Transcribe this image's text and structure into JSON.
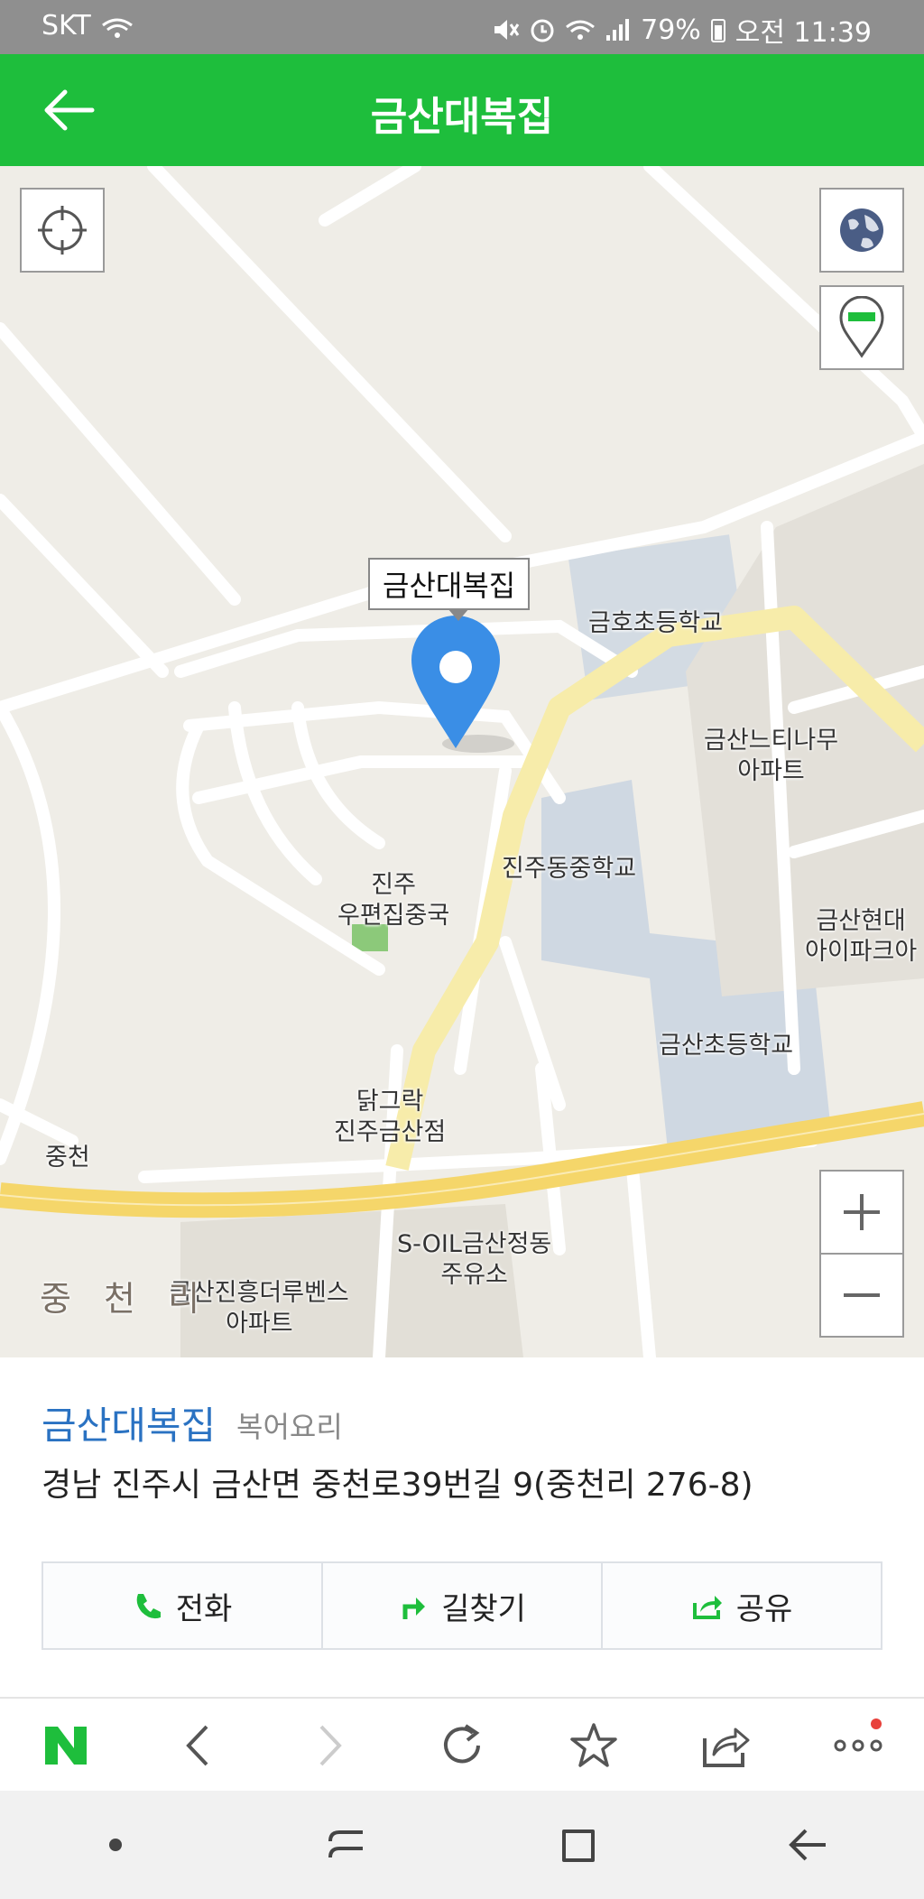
{
  "status_bar": {
    "carrier": "SKT",
    "battery": "79%",
    "time": "오전 11:39"
  },
  "app_bar": {
    "title": "금산대복집"
  },
  "map": {
    "callout": "금산대복집",
    "labels": {
      "school_geumho": "금호초등학교",
      "apt_neuti": "금산느티나무\n아파트",
      "school_jinjudong": "진주동중학교",
      "post_office": "진주\n우편집중국",
      "apt_hyundai": "금산현대\n아이파크아",
      "school_geumsan": "금산초등학교",
      "restaurant_chicken": "닭그락\n진주금산점",
      "jungcheon": "중천",
      "gas_station": "S-OIL금산정동\n주유소",
      "apt_jinheung": "금산진흥더루벤스\n아파트",
      "village": "중 천 리"
    }
  },
  "place": {
    "name": "금산대복집",
    "category": "복어요리",
    "address": "경남 진주시 금산면 중천로39번길 9(중천리 276-8)"
  },
  "actions": {
    "call": "전화",
    "directions": "길찾기",
    "share": "공유"
  },
  "colors": {
    "brand_green": "#1ebe3c",
    "link_blue": "#2a72c2",
    "pin_blue": "#3a8ee6"
  }
}
